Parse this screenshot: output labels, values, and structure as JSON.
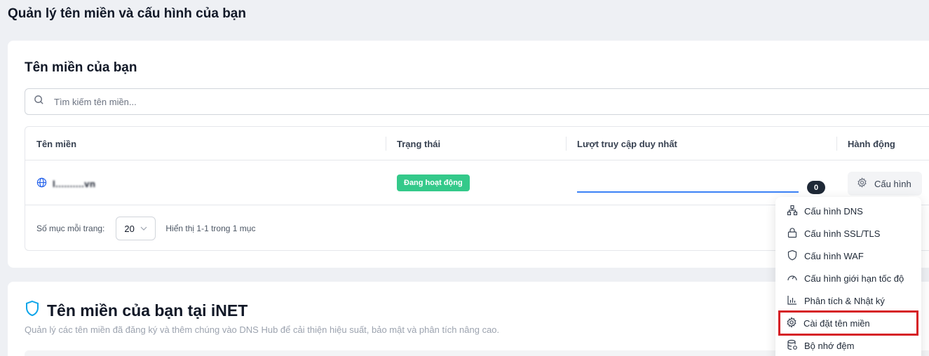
{
  "page": {
    "title": "Quản lý tên miền và cấu hình của bạn"
  },
  "domains_card": {
    "title": "Tên miền của bạn",
    "search": {
      "placeholder": "Tìm kiếm tên miền...",
      "value": ""
    },
    "table": {
      "columns": [
        "Tên miền",
        "Trạng thái",
        "Lượt truy cập duy nhất",
        "Hành động"
      ],
      "rows": [
        {
          "domain": "l..........vn",
          "status": "Đang hoạt động",
          "unique_visits": "0",
          "action_label": "Cấu hình"
        }
      ]
    },
    "pagination": {
      "per_page_label": "Số mục mỗi trang:",
      "per_page_value": "20",
      "info": "Hiển thị 1-1 trong 1 mục"
    }
  },
  "inet_card": {
    "title": "Tên miền của bạn tại iNET",
    "description": "Quản lý các tên miền đã đăng ký và thêm chúng vào DNS Hub để cải thiện hiệu suất, bảo mật và phân tích nâng cao."
  },
  "config_menu": {
    "items": [
      {
        "label": "Cấu hình DNS",
        "icon": "network-icon"
      },
      {
        "label": "Cấu hình SSL/TLS",
        "icon": "lock-icon"
      },
      {
        "label": "Cấu hình WAF",
        "icon": "shield-icon"
      },
      {
        "label": "Cấu hình giới hạn tốc độ",
        "icon": "gauge-icon"
      },
      {
        "label": "Phân tích & Nhật ký",
        "icon": "bar-chart-icon"
      },
      {
        "label": "Cài đặt tên miền",
        "icon": "gear-icon",
        "highlighted": true
      },
      {
        "label": "Bộ nhớ đệm",
        "icon": "database-icon"
      }
    ]
  },
  "colors": {
    "status_active": "#34c98a",
    "accent": "#3b82f6",
    "highlight_border": "#d61f26",
    "inet_shield": "#0ea5e9"
  }
}
